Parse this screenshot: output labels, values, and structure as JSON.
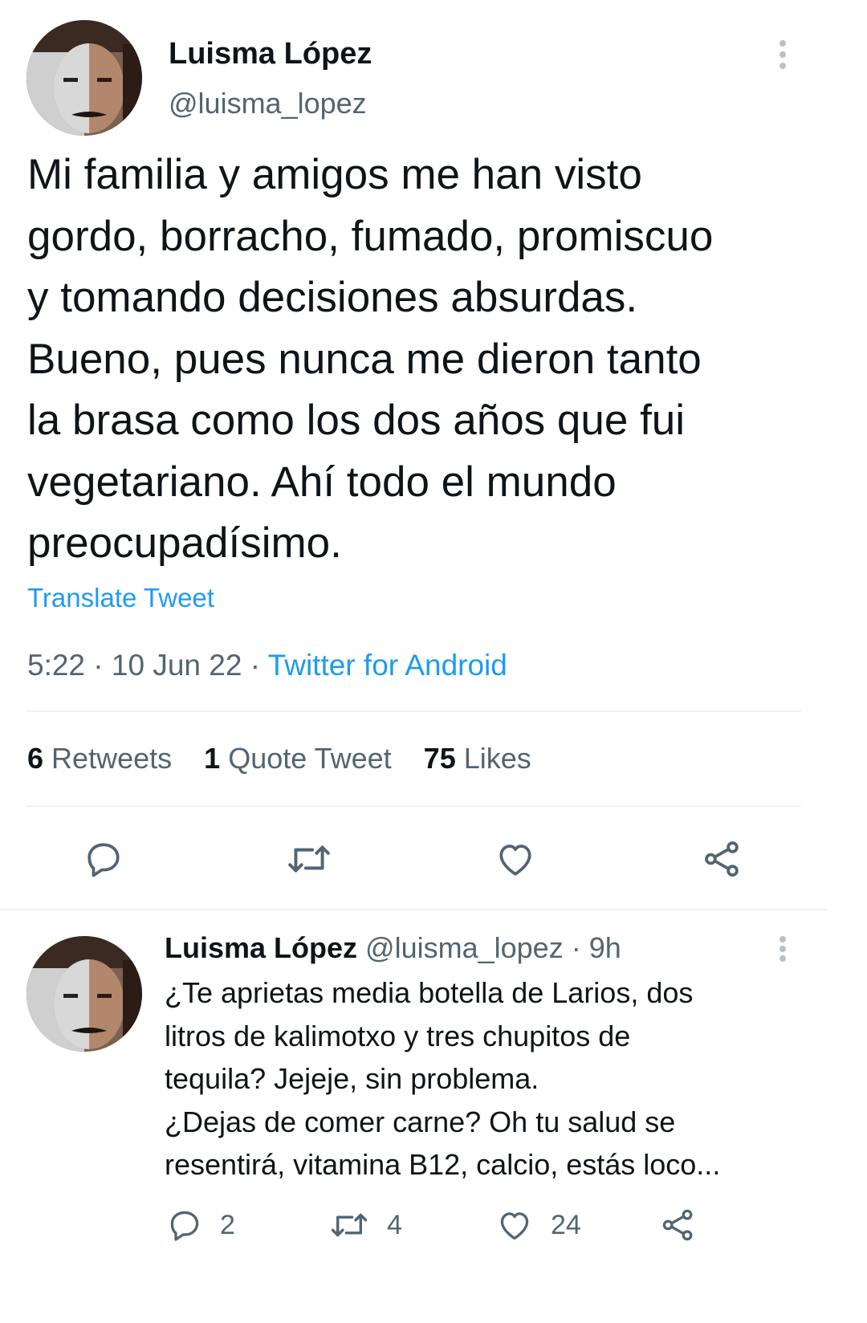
{
  "main_tweet": {
    "author_name": "Luisma López",
    "author_handle": "@luisma_lopez",
    "text_lines": [
      "Mi familia y amigos me han visto",
      "gordo, borracho, fumado, promiscuo",
      "y tomando decisiones absurdas.",
      "Bueno, pues nunca me dieron tanto",
      "la brasa como los dos años que fui",
      "vegetariano. Ahí todo el mundo",
      "preocupadísimo."
    ],
    "translate_label": "Translate Tweet",
    "time": "5:22",
    "date": "10 Jun 22",
    "separator": "·",
    "source": "Twitter for Android",
    "stats": {
      "retweets_count": "6",
      "retweets_label": "Retweets",
      "quotes_count": "1",
      "quotes_label": "Quote Tweet",
      "likes_count": "75",
      "likes_label": "Likes"
    },
    "actions": [
      "reply-icon",
      "retweet-icon",
      "like-icon",
      "share-icon"
    ]
  },
  "reply_tweet": {
    "author_name": "Luisma López",
    "author_handle": "@luisma_lopez",
    "separator": "·",
    "time_ago": "9h",
    "text_lines": [
      "¿Te aprietas media botella de Larios, dos",
      "litros de kalimotxo y tres chupitos de",
      "tequila? Jejeje, sin problema.",
      "¿Dejas de comer carne? Oh tu salud se",
      "resentirá, vitamina B12, calcio, estás loco..."
    ],
    "reply_count": "2",
    "retweet_count": "4",
    "like_count": "24"
  },
  "colors": {
    "accent": "#1d9bf0",
    "muted": "#536471",
    "text": "#0f1419",
    "divider": "#eff3f4"
  }
}
